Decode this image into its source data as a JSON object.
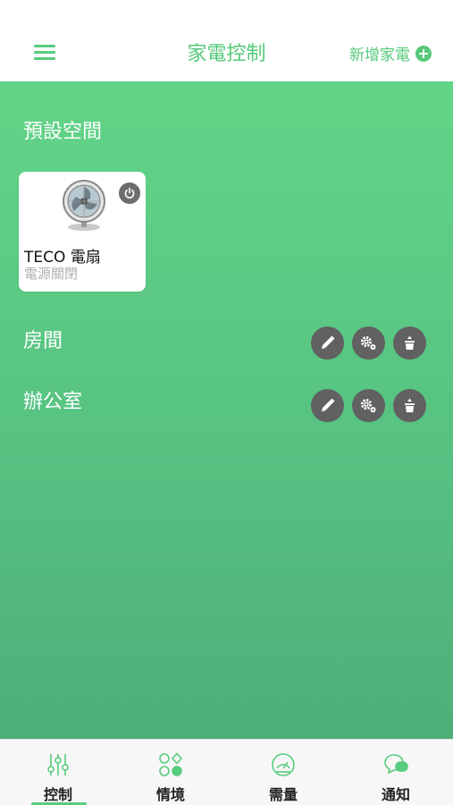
{
  "header": {
    "title": "家電控制",
    "add_label": "新增家電",
    "menu_icon": "hamburger-menu-icon",
    "add_icon": "plus-circle-icon"
  },
  "sections": {
    "default_space": {
      "title": "預設空間",
      "devices": [
        {
          "name": "TECO 電扇",
          "status": "電源關閉",
          "icon": "fan-icon"
        }
      ]
    },
    "rooms": [
      {
        "title": "房間"
      },
      {
        "title": "辦公室"
      }
    ]
  },
  "tabs": [
    {
      "label": "控制",
      "icon": "sliders-icon",
      "active": true
    },
    {
      "label": "情境",
      "icon": "scenes-icon",
      "active": false
    },
    {
      "label": "需量",
      "icon": "gauge-icon",
      "active": false
    },
    {
      "label": "通知",
      "icon": "chat-bubbles-icon",
      "active": false
    }
  ],
  "colors": {
    "accent": "#58cc7e",
    "gradient_top": "#62d487",
    "gradient_bottom": "#4eae79",
    "action_button": "#616161"
  }
}
